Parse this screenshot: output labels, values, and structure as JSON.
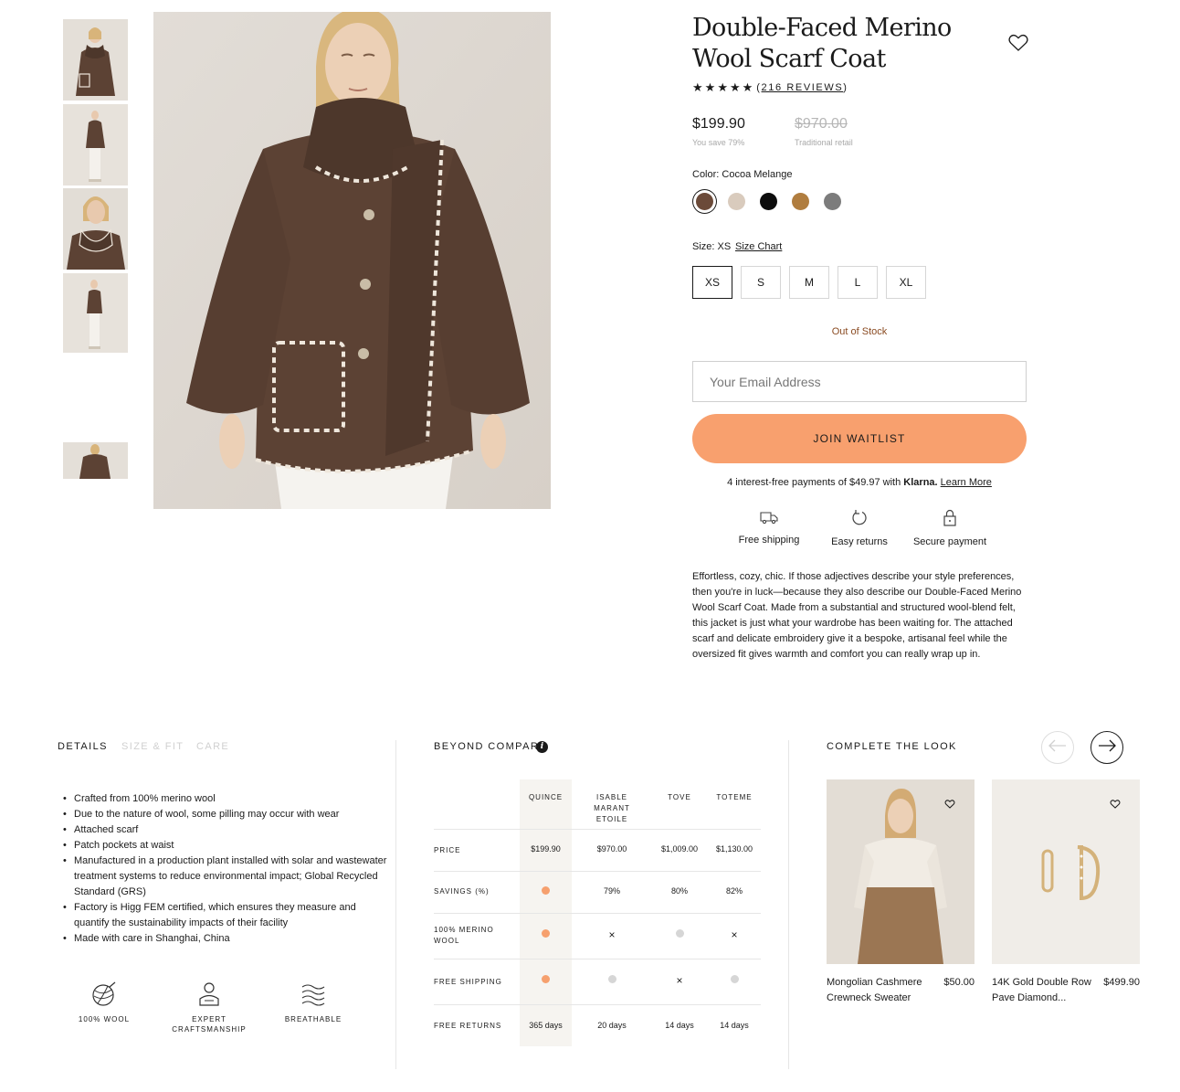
{
  "product": {
    "title": "Double-Faced Merino Wool Scarf Coat",
    "rating_stars": 5,
    "reviews_open": "(",
    "reviews_label": "216 REVIEWS",
    "reviews_close": ")",
    "price": "$199.90",
    "savings": "You save 79%",
    "retail_price": "$970.00",
    "retail_label": "Traditional retail",
    "color_label": "Color: Cocoa Melange",
    "colors": [
      {
        "name": "Cocoa Melange",
        "hex": "#6b4a39"
      },
      {
        "name": "Oatmeal",
        "hex": "#d9cbbd"
      },
      {
        "name": "Black",
        "hex": "#0d0d0d"
      },
      {
        "name": "Camel",
        "hex": "#b07d3f"
      },
      {
        "name": "Grey",
        "hex": "#7c7c7c"
      }
    ],
    "size_label": "Size: XS",
    "size_chart": "Size Chart",
    "sizes": [
      "XS",
      "S",
      "M",
      "L",
      "XL"
    ],
    "selected_size": "XS",
    "stock_status": "Out of Stock",
    "email_placeholder": "Your Email Address",
    "waitlist_button": "JOIN WAITLIST",
    "klarna_text": "4 interest-free payments of $49.97 with",
    "klarna_brand": "Klarna.",
    "klarna_link": "Learn More",
    "perks": [
      "Free shipping",
      "Easy returns",
      "Secure payment"
    ],
    "description": "Effortless, cozy, chic. If those adjectives describe your style preferences, then you're in luck—because they also describe our Double-Faced Merino Wool Scarf Coat. Made from a substantial and structured wool-blend felt, this jacket is just what your wardrobe has been waiting for. The attached scarf and delicate embroidery give it a bespoke, artisanal feel while the oversized fit gives warmth and comfort you can really wrap up in."
  },
  "details": {
    "tabs": [
      "DETAILS",
      "SIZE & FIT",
      "CARE"
    ],
    "bullets": [
      "Crafted from 100% merino wool",
      "Due to the nature of wool, some pilling may occur with wear",
      "Attached scarf",
      "Patch pockets at waist",
      "Manufactured in a production plant installed with solar and wastewater treatment systems to reduce environmental impact; Global Recycled Standard (GRS)",
      "Factory is Higg FEM certified, which ensures they measure and quantify the sustainability impacts of their facility",
      "Made with care in Shanghai, China"
    ],
    "features": [
      "100% WOOL",
      "EXPERT CRAFTSMANSHIP",
      "BREATHABLE"
    ]
  },
  "compare": {
    "title": "BEYOND COMPARE",
    "info_icon": "i",
    "brands": [
      "QUINCE",
      "ISABLE MARANT ETOILE",
      "TOVE",
      "TOTEME"
    ],
    "rows": [
      {
        "label": "PRICE",
        "cells": [
          "$199.90",
          "$970.00",
          "$1,009.00",
          "$1,130.00"
        ]
      },
      {
        "label": "SAVINGS (%)",
        "cells": [
          "dot-orange",
          "79%",
          "80%",
          "82%"
        ]
      },
      {
        "label": "100% MERINO WOOL",
        "cells": [
          "dot-orange",
          "×",
          "dot-grey",
          "×"
        ]
      },
      {
        "label": "FREE SHIPPING",
        "cells": [
          "dot-orange",
          "dot-grey",
          "×",
          "dot-grey"
        ]
      },
      {
        "label": "FREE RETURNS",
        "cells": [
          "365 days",
          "20 days",
          "14 days",
          "14 days"
        ]
      }
    ]
  },
  "complete_look": {
    "title": "COMPLETE THE LOOK",
    "items": [
      {
        "name": "Mongolian Cashmere Crewneck Sweater",
        "price": "$50.00"
      },
      {
        "name": "14K Gold Double Row Pave Diamond...",
        "price": "$499.90"
      }
    ]
  },
  "theme": {
    "accent": "#f8a06e",
    "oos_color": "#8a4b22",
    "coat_color": "#5c4234"
  }
}
